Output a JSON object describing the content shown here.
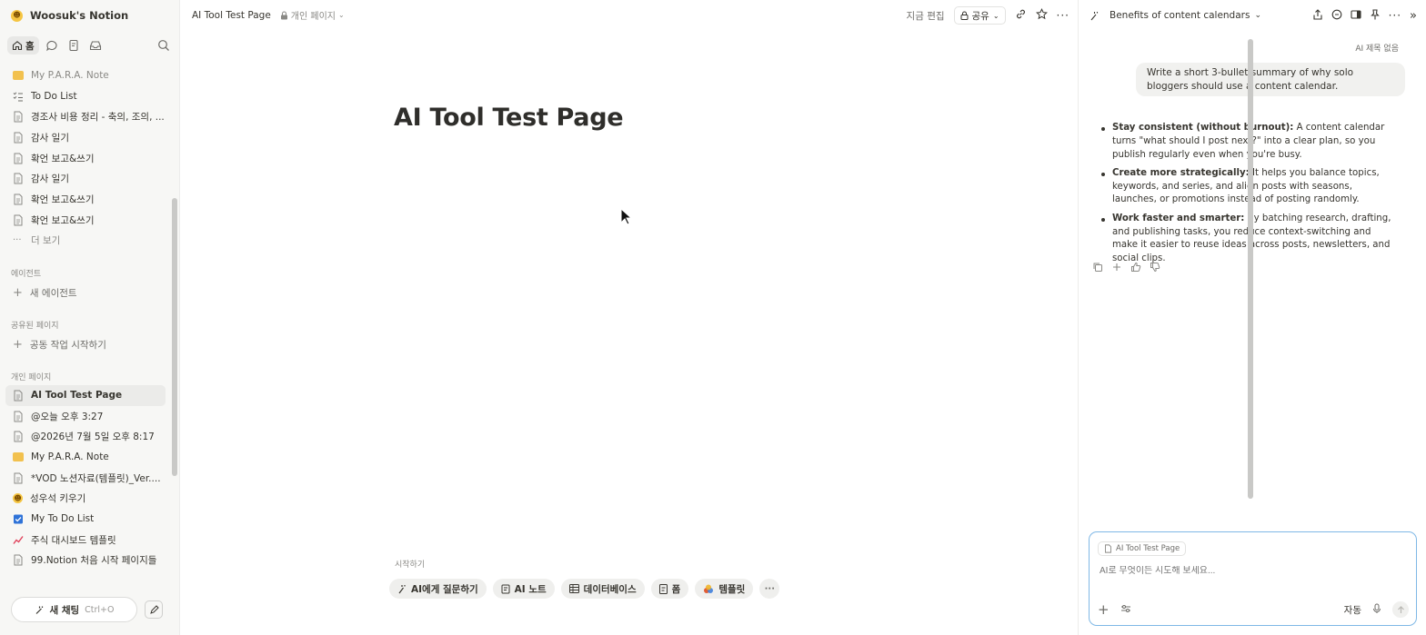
{
  "workspace": {
    "name": "Woosuk's Notion"
  },
  "nav": {
    "home_label": "홈"
  },
  "sidebar": {
    "recent_items": [
      {
        "label": "My P.A.R.A. Note",
        "icon": "folder-emoji-icon",
        "muted": true
      },
      {
        "label": "To Do List",
        "icon": "checklist-icon"
      },
      {
        "label": "경조사 비용 정리 - 축의, 조의, ...",
        "icon": "page-icon"
      },
      {
        "label": "감사 일기",
        "icon": "page-icon"
      },
      {
        "label": "확언 보고&쓰기",
        "icon": "page-icon"
      },
      {
        "label": "감사 일기",
        "icon": "page-icon"
      },
      {
        "label": "확언 보고&쓰기",
        "icon": "page-icon"
      },
      {
        "label": "확언 보고&쓰기",
        "icon": "page-icon"
      }
    ],
    "more_label": "더 보기",
    "agents_section": "에이전트",
    "new_agent": "새 에이전트",
    "shared_section": "공유된 페이지",
    "start_collab": "공동 작업 시작하기",
    "private_section": "개인 페이지",
    "private_items": [
      {
        "label": "AI Tool Test Page",
        "icon": "page-icon",
        "active": true
      },
      {
        "label": "@오늘 오후 3:27",
        "icon": "page-icon"
      },
      {
        "label": "@2026년 7월 5일 오후 8:17",
        "icon": "page-icon"
      },
      {
        "label": "My P.A.R.A. Note",
        "icon": "folder-emoji-icon"
      },
      {
        "label": "*VOD 노션자료(템플릿)_Ver....",
        "icon": "page-icon"
      },
      {
        "label": "성우석 키우기",
        "icon": "smiley-emoji-icon"
      },
      {
        "label": "My To Do List",
        "icon": "checkbox-icon"
      },
      {
        "label": "주식 대시보드 템플릿",
        "icon": "chart-emoji-icon"
      },
      {
        "label": "99.Notion 처음 시작 페이지들",
        "icon": "page-icon"
      }
    ],
    "new_chat": "새 채팅",
    "new_chat_shortcut": "Ctrl+O"
  },
  "topbar": {
    "page_name": "AI Tool Test Page",
    "privacy": "개인 페이지",
    "edited": "지금 편집",
    "share": "공유"
  },
  "page": {
    "title": "AI Tool Test Page",
    "start_label": "시작하기",
    "chips": [
      {
        "label": "AI에게 질문하기",
        "icon": "ai-icon"
      },
      {
        "label": "AI 노트",
        "icon": "ai-notes-icon"
      },
      {
        "label": "데이터베이스",
        "icon": "table-icon"
      },
      {
        "label": "폼",
        "icon": "form-icon"
      },
      {
        "label": "템플릿",
        "icon": "template-icon"
      }
    ]
  },
  "ai_panel": {
    "title": "Benefits of content calendars",
    "no_title": "AI 제목 없음",
    "user_message": "Write a short 3-bullet summary of why solo bloggers should use a content calendar.",
    "bullets": [
      {
        "bold": "Stay consistent (without burnout):",
        "text": " A content calendar turns \"what should I post next?\" into a clear plan, so you publish regularly even when you're busy."
      },
      {
        "bold": "Create more strategically:",
        "text": " It helps you balance topics, keywords, and series, and align posts with seasons, launches, or promotions instead of posting randomly."
      },
      {
        "bold": "Work faster and smarter:",
        "text": " By batching research, drafting, and publishing tasks, you reduce context-switching and make it easier to reuse ideas across posts, newsletters, and social clips."
      }
    ],
    "context_chip": "AI Tool Test Page",
    "input_placeholder": "AI로 무엇이든 시도해 보세요...",
    "mode": "자동"
  }
}
